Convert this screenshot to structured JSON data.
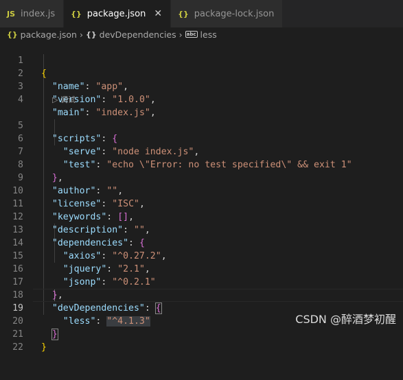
{
  "tabs": [
    {
      "icon": "JS",
      "label": "index.js",
      "active": false
    },
    {
      "icon": "{}",
      "label": "package.json",
      "active": true,
      "close": "✕"
    },
    {
      "icon": "{}",
      "label": "package-lock.json",
      "active": false
    }
  ],
  "breadcrumb": {
    "file": "package.json",
    "section": "devDependencies",
    "key": "less"
  },
  "codelens": "▷ 调试",
  "lines": [
    {
      "n": "1"
    },
    {
      "n": "2"
    },
    {
      "n": "3"
    },
    {
      "n": "4"
    },
    {
      "n": "5"
    },
    {
      "n": "6"
    },
    {
      "n": "7"
    },
    {
      "n": "8"
    },
    {
      "n": "9"
    },
    {
      "n": "10"
    },
    {
      "n": "11"
    },
    {
      "n": "12"
    },
    {
      "n": "13"
    },
    {
      "n": "14"
    },
    {
      "n": "15"
    },
    {
      "n": "16"
    },
    {
      "n": "17"
    },
    {
      "n": "18"
    },
    {
      "n": "19"
    },
    {
      "n": "20"
    },
    {
      "n": "21"
    },
    {
      "n": "22"
    }
  ],
  "json": {
    "name_key": "\"name\"",
    "name_val": "\"app\"",
    "version_key": "\"version\"",
    "version_val": "\"1.0.0\"",
    "main_key": "\"main\"",
    "main_val": "\"index.js\"",
    "scripts_key": "\"scripts\"",
    "serve_key": "\"serve\"",
    "serve_val": "\"node index.js\"",
    "test_key": "\"test\"",
    "test_val": "\"echo \\\"Error: no test specified\\\" && exit 1\"",
    "author_key": "\"author\"",
    "author_val": "\"\"",
    "license_key": "\"license\"",
    "license_val": "\"ISC\"",
    "keywords_key": "\"keywords\"",
    "keywords_val": "[]",
    "description_key": "\"description\"",
    "description_val": "\"\"",
    "dependencies_key": "\"dependencies\"",
    "axios_key": "\"axios\"",
    "axios_val": "\"^0.27.2\"",
    "jquery_key": "\"jquery\"",
    "jquery_val": "\"2.1\"",
    "jsonp_key": "\"jsonp\"",
    "jsonp_val": "\"^0.2.1\"",
    "devDependencies_key": "\"devDependencies\"",
    "less_key": "\"less\"",
    "less_val": "\"^4.1.3\""
  },
  "watermark": "CSDN @醉酒梦初醒",
  "colors": {
    "background": "#1e1e1e",
    "key": "#9cdcfe",
    "string": "#ce9178",
    "bracket_outer": "#ffd700",
    "bracket_inner": "#da70d6"
  }
}
